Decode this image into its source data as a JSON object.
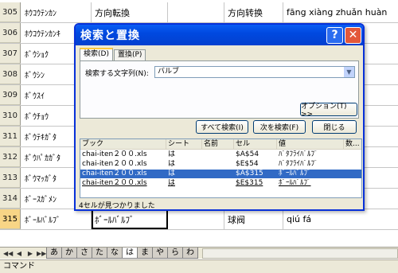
{
  "sheet": {
    "rows": [
      {
        "num": "305",
        "a": "ﾎｳｺｳﾃﾝｶﾝ",
        "b": "方向転換",
        "c": "",
        "d": "方向转换",
        "e": "fāng xiàng zhuǎn huàn"
      },
      {
        "num": "306",
        "a": "ﾎｳｺｳﾃﾝｶﾝｷ",
        "b": "",
        "c": "",
        "d": "",
        "e": "huàn"
      },
      {
        "num": "307",
        "a": "ﾎﾞｳｼｮｸ",
        "b": "",
        "c": "",
        "d": "",
        "e": ""
      },
      {
        "num": "308",
        "a": "ﾎﾞｳｼﾝ",
        "b": "",
        "c": "",
        "d": "",
        "e": ""
      },
      {
        "num": "309",
        "a": "ﾎﾞｳｽｲ",
        "b": "",
        "c": "",
        "d": "",
        "e": ""
      },
      {
        "num": "310",
        "a": "ﾎﾞｳﾁｮｳ",
        "b": "",
        "c": "",
        "d": "",
        "e": ""
      },
      {
        "num": "311",
        "a": "ﾎﾞｳﾃｷｶﾞﾀ",
        "b": "",
        "c": "",
        "d": "",
        "e": ""
      },
      {
        "num": "312",
        "a": "ﾎﾞｳﾊﾟｶｶﾞﾀ",
        "b": "",
        "c": "",
        "d": "",
        "e": ""
      },
      {
        "num": "313",
        "a": "ﾎﾞｳﾏｯｶﾞﾀ",
        "b": "",
        "c": "",
        "d": "",
        "e": ""
      },
      {
        "num": "314",
        "a": "ﾎﾞｰｽｶﾞﾒﾝ",
        "b": "",
        "c": "",
        "d": "",
        "e": "n"
      },
      {
        "num": "315",
        "a": "ﾎﾞｰﾙﾊﾞﾙﾌﾞ",
        "b": "ﾎﾞｰﾙﾊﾞﾙﾌﾞ",
        "c": "",
        "d": "球阀",
        "e": "qiú fá"
      }
    ],
    "tabs": [
      "あ",
      "か",
      "さ",
      "た",
      "な",
      "は",
      "ま",
      "や",
      "ら",
      "わ"
    ],
    "active_tab_index": 5,
    "nav_buttons": [
      "◀◀",
      "◀",
      "▶",
      "▶▶"
    ],
    "status": "コマンド"
  },
  "dialog": {
    "title": "検索と置換",
    "help_label": "?",
    "close_label": "✕",
    "tabs": [
      "検索(D)",
      "置換(P)"
    ],
    "search_label": "検索する文字列(N):",
    "search_value": "バルブ",
    "options_button": "オプション(T) >>",
    "find_all_button": "すべて検索(I)",
    "find_next_button": "次を検索(F)",
    "close_button": "閉じる",
    "results": {
      "headers": [
        "ブック",
        "シート",
        "名前",
        "セル",
        "値",
        "数..."
      ],
      "rows": [
        {
          "book": "chai-iten２００.xls",
          "sheet": "は",
          "name": "",
          "cell": "$A$54",
          "value": "ﾊﾞﾀﾌﾗｲﾊﾞﾙﾌﾞ",
          "formula": ""
        },
        {
          "book": "chai-iten２００.xls",
          "sheet": "は",
          "name": "",
          "cell": "$E$54",
          "value": "ﾊﾞﾀﾌﾗｲﾊﾞﾙﾌﾞ",
          "formula": ""
        },
        {
          "book": "chai-iten２００.xls",
          "sheet": "は",
          "name": "",
          "cell": "$A$315",
          "value": "ﾎﾞｰﾙﾊﾞﾙﾌﾞ",
          "formula": ""
        },
        {
          "book": "chai-iten２００.xls",
          "sheet": "は",
          "name": "",
          "cell": "$E$315",
          "value": "ﾎﾞｰﾙﾊﾞﾙﾌﾞ",
          "formula": ""
        }
      ],
      "selected_index": 2,
      "hover_index": 3
    },
    "status": "4セルが見つかりました"
  },
  "colors": {
    "title_bar": "#0049e0",
    "selection": "#316ac5",
    "active_row_header": "#f8d586"
  }
}
